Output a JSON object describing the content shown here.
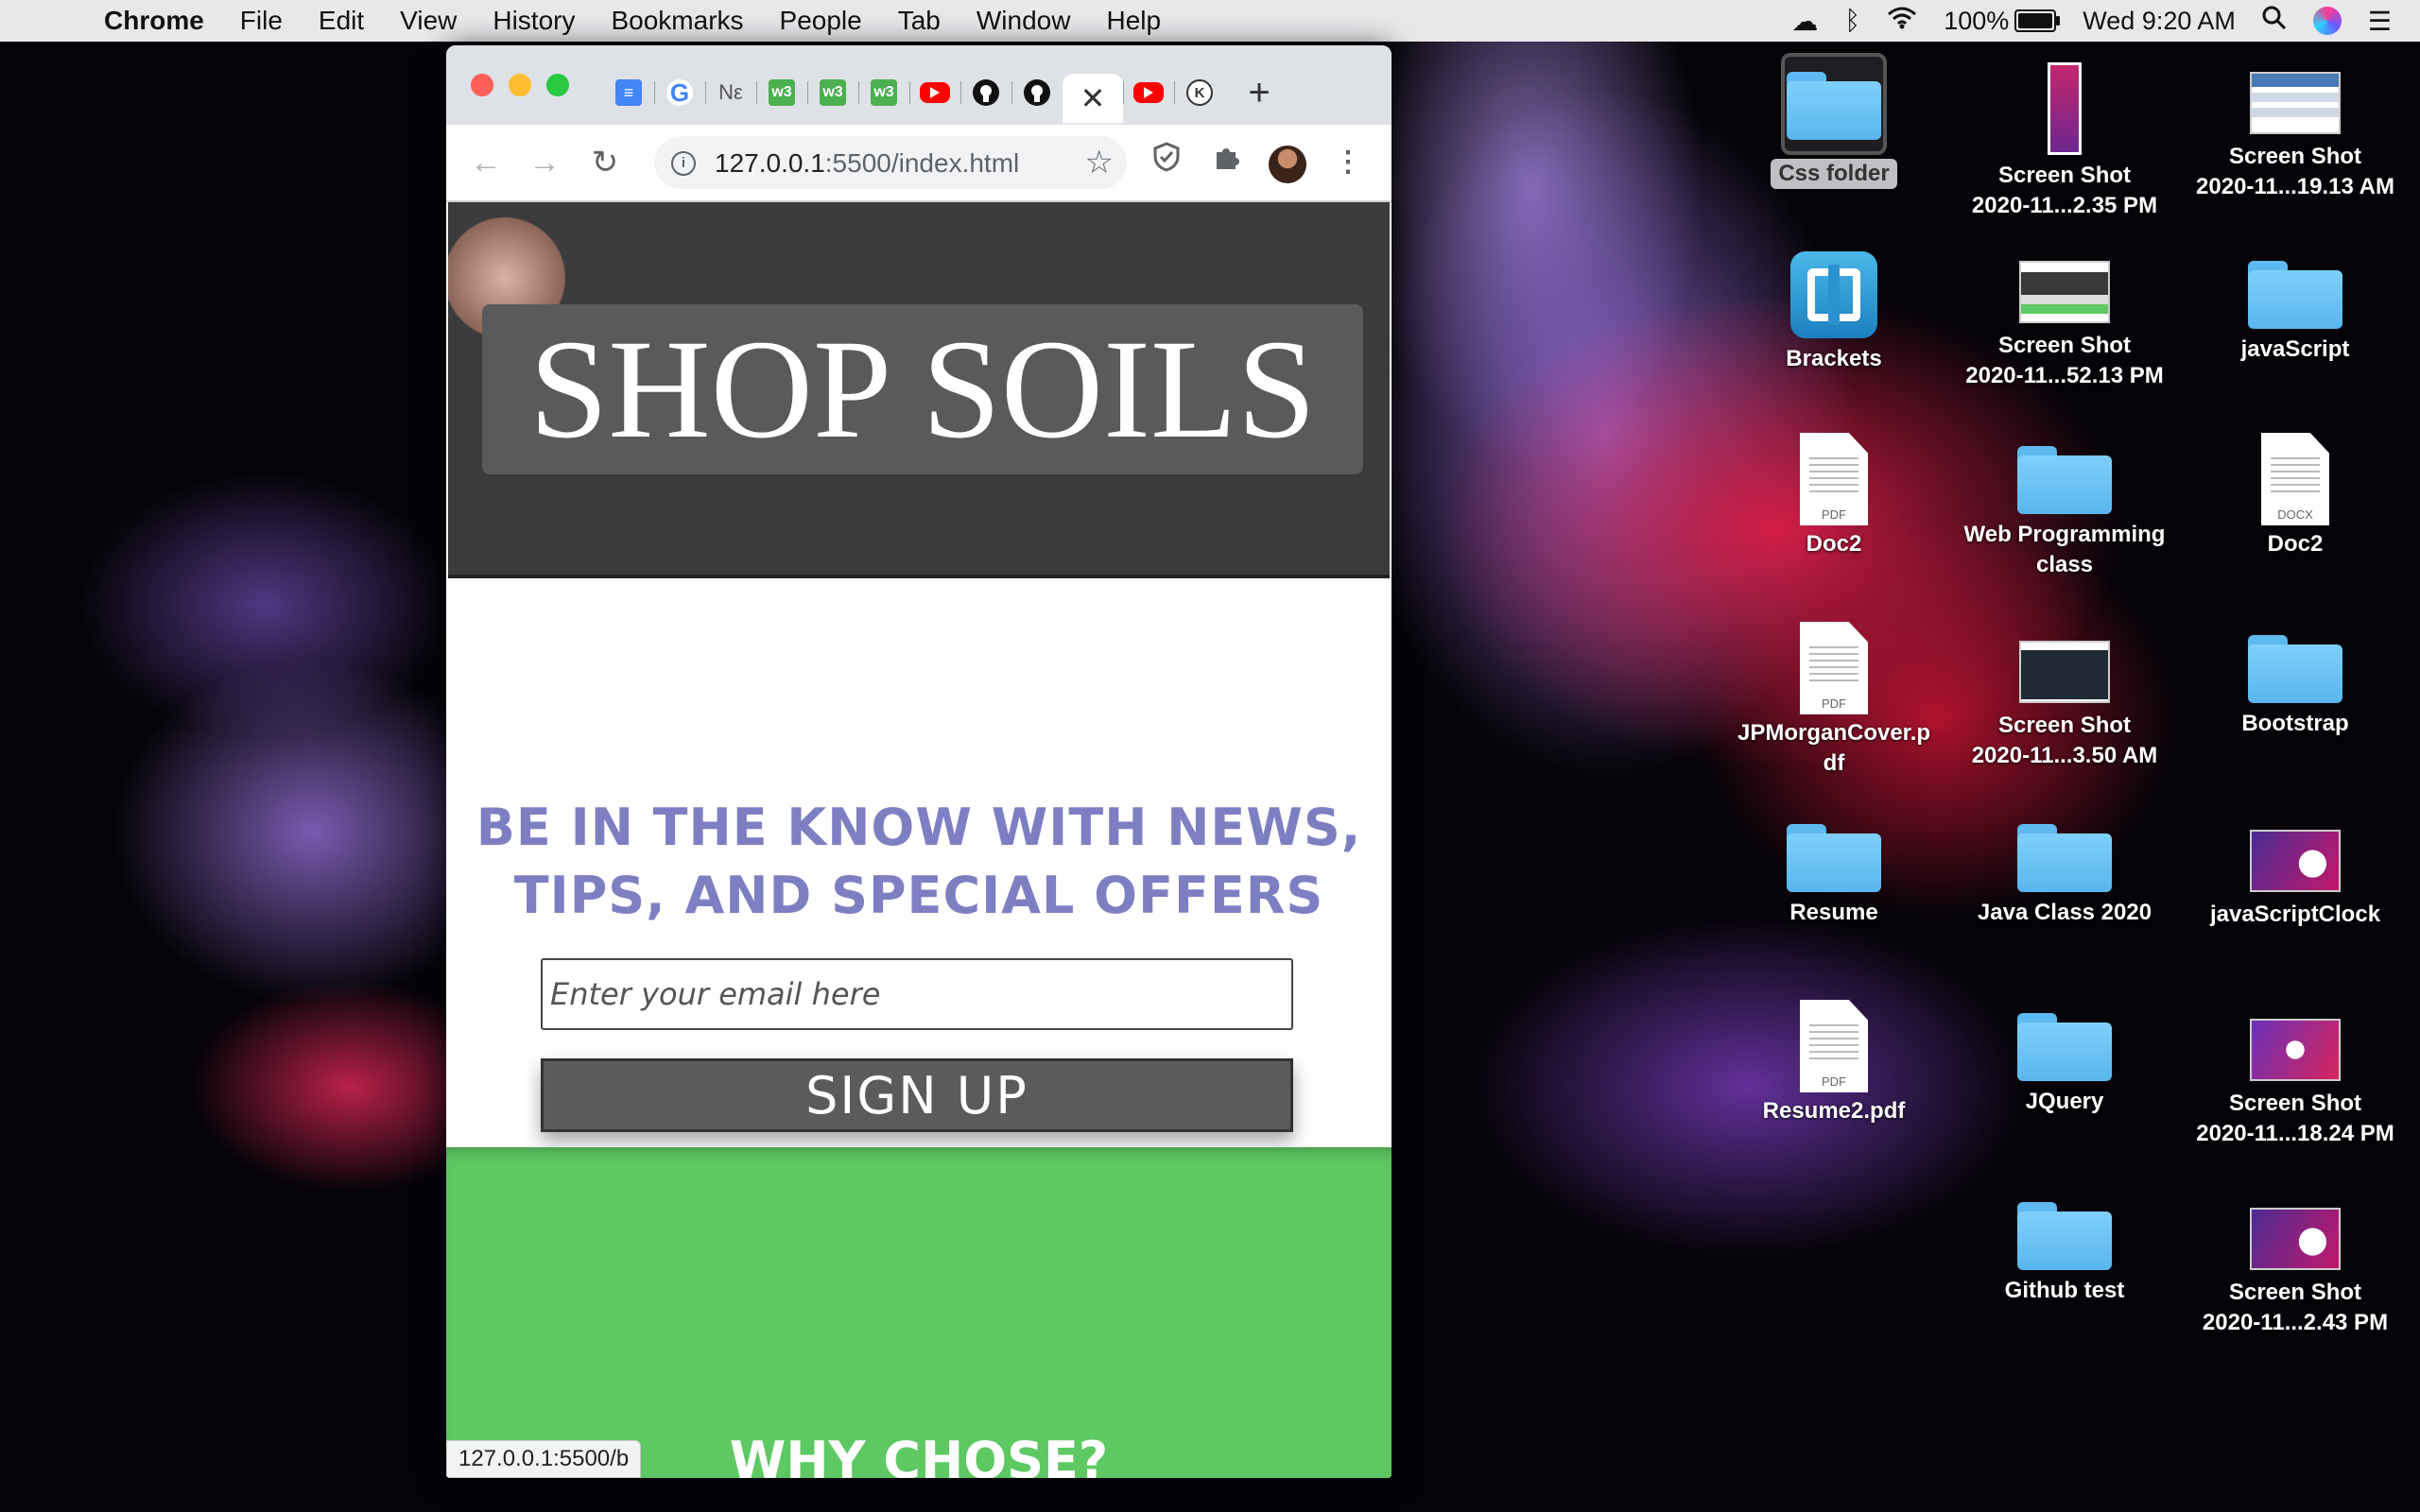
{
  "menubar": {
    "apple": "",
    "app_name": "Chrome",
    "items": [
      "File",
      "Edit",
      "View",
      "History",
      "Bookmarks",
      "People",
      "Tab",
      "Window",
      "Help"
    ],
    "battery_percent": "100%",
    "clock": "Wed 9:20 AM",
    "battery_level": 1.0
  },
  "browser": {
    "tabs": [
      {
        "icon": "google-docs-icon",
        "glyph": "≡"
      },
      {
        "icon": "google-icon",
        "glyph": "G"
      },
      {
        "icon": "ne-icon",
        "glyph": "Nε"
      },
      {
        "icon": "w3schools-icon",
        "glyph": "w3"
      },
      {
        "icon": "w3schools-icon",
        "glyph": "w3"
      },
      {
        "icon": "w3schools-icon",
        "glyph": "w3"
      },
      {
        "icon": "youtube-icon",
        "glyph": ""
      },
      {
        "icon": "github-icon",
        "glyph": ""
      },
      {
        "icon": "github-icon",
        "glyph": ""
      },
      {
        "icon": "close-icon",
        "glyph": "✕"
      },
      {
        "icon": "youtube-icon",
        "glyph": ""
      },
      {
        "icon": "k-icon",
        "glyph": "K"
      }
    ],
    "new_tab_glyph": "+",
    "url_host": "127.0.0.1",
    "url_rest": ":5500/index.html",
    "status_url": "127.0.0.1:5500/b"
  },
  "page": {
    "hero_title": "SHOP SOILS",
    "newsletter_heading": "BE IN THE KNOW WITH NEWS, TIPS, AND SPECIAL OFFERS",
    "email_placeholder": "Enter your email here",
    "signup_label": "SIGN UP",
    "next_heading": "WHY CHOSE?"
  },
  "desktop": {
    "icons": [
      {
        "label": "Css folder",
        "type": "folder",
        "selected": true
      },
      {
        "label": "Screen Shot\n2020-11...2.35 PM",
        "type": "screenshot"
      },
      {
        "label": "Screen Shot\n2020-11...19.13 AM",
        "type": "screenshot"
      },
      {
        "label": "Brackets",
        "type": "app"
      },
      {
        "label": "Screen Shot\n2020-11...52.13 PM",
        "type": "screenshot"
      },
      {
        "label": "javaScript",
        "type": "folder"
      },
      {
        "label": "Doc2",
        "type": "pdf",
        "badge": "PDF"
      },
      {
        "label": "Web Programming\nclass",
        "type": "folder"
      },
      {
        "label": "Doc2",
        "type": "docx",
        "badge": "DOCX"
      },
      {
        "label": "JPMorganCover.p\ndf",
        "type": "pdf",
        "badge": "PDF"
      },
      {
        "label": "Screen Shot\n2020-11...3.50 AM",
        "type": "screenshot"
      },
      {
        "label": "Bootstrap",
        "type": "folder"
      },
      {
        "label": "Resume",
        "type": "folder"
      },
      {
        "label": "Java Class 2020",
        "type": "folder"
      },
      {
        "label": "javaScriptClock",
        "type": "screenshot"
      },
      {
        "label": "Resume2.pdf",
        "type": "pdf",
        "badge": "PDF"
      },
      {
        "label": "JQuery",
        "type": "folder"
      },
      {
        "label": "Screen Shot\n2020-11...18.24 PM",
        "type": "screenshot"
      },
      {
        "label": "Github test",
        "type": "folder"
      },
      {
        "label": "Screen Shot\n2020-11...2.43 PM",
        "type": "screenshot"
      }
    ]
  }
}
